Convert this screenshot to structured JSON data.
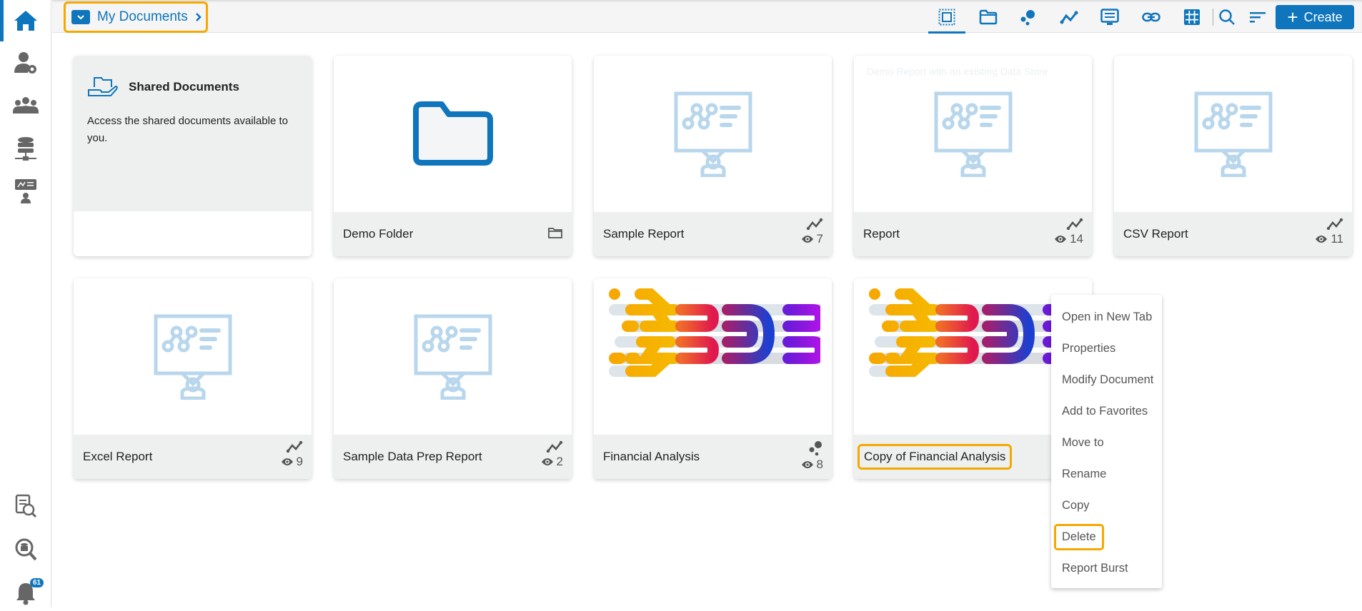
{
  "sidebar": {
    "items": [
      {
        "name": "home",
        "icon": "home-icon"
      },
      {
        "name": "user-settings",
        "icon": "user-gear-icon"
      },
      {
        "name": "groups",
        "icon": "users-icon"
      },
      {
        "name": "data-connectors",
        "icon": "database-network-icon"
      },
      {
        "name": "presentation",
        "icon": "presenter-icon"
      },
      {
        "name": "data-catalog",
        "icon": "catalog-search-icon"
      },
      {
        "name": "search-data",
        "icon": "search-database-icon"
      },
      {
        "name": "notifications",
        "icon": "bell-icon",
        "badge": "61"
      }
    ]
  },
  "breadcrumb": {
    "label": "My Documents"
  },
  "toolbar": {
    "icons": [
      "select-all-icon",
      "folder-icon",
      "bubble-chart-icon",
      "line-chart-icon",
      "presentation-icon",
      "link-icon",
      "grid-icon",
      "search-icon",
      "sort-icon"
    ],
    "create_label": "Create"
  },
  "shared": {
    "title": "Shared Documents",
    "description": "Access the shared documents available to you."
  },
  "cards": [
    {
      "title": "Demo Folder",
      "type": "folder"
    },
    {
      "title": "Sample Report",
      "type": "report",
      "views": "7"
    },
    {
      "title": "Report",
      "type": "report",
      "views": "14",
      "description": "Demo Report with an existing Data Store"
    },
    {
      "title": "CSV Report",
      "type": "report",
      "views": "11"
    },
    {
      "title": "Excel Report",
      "type": "report",
      "views": "9"
    },
    {
      "title": "Sample Data Prep Report",
      "type": "report",
      "views": "2"
    },
    {
      "title": "Financial Analysis",
      "type": "story",
      "views": "8"
    },
    {
      "title": "Copy of Financial Analysis",
      "type": "story",
      "highlighted": true
    }
  ],
  "context_menu": {
    "items": [
      "Open in New Tab",
      "Properties",
      "Modify Document",
      "Add to Favorites",
      "Move to",
      "Rename",
      "Copy",
      "Delete",
      "Report Burst"
    ],
    "highlighted": "Delete"
  },
  "colors": {
    "accent": "#0f75bc",
    "highlight": "#f5a800",
    "icon_light": "#b8d6ec"
  }
}
